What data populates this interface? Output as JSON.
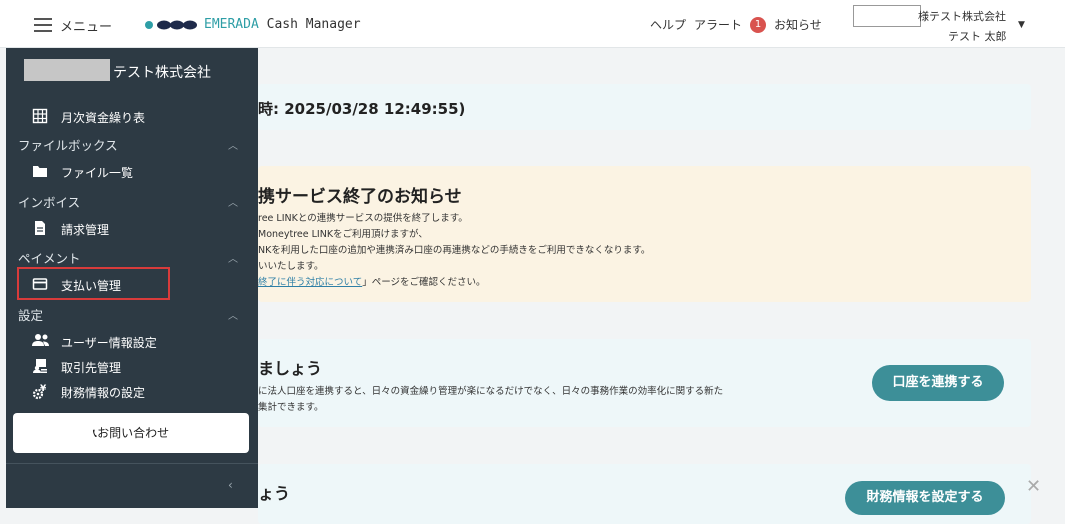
{
  "header": {
    "menu_label": "メニュー",
    "brand_primary": "EMERADA",
    "brand_secondary": "Cash Manager",
    "help": "ヘルプ",
    "alert": "アラート",
    "alert_count": "1",
    "notice": "お知らせ",
    "company_suffix": "様テスト株式会社",
    "user_name": "テスト 太郎",
    "accent_color": "#2e9ea6"
  },
  "sidebar": {
    "company_name": "テスト株式会社",
    "items": [
      {
        "label": "月次資金繰り表",
        "icon": "table-icon"
      },
      {
        "label": "ファイル一覧",
        "icon": "folder-icon"
      },
      {
        "label": "請求管理",
        "icon": "document-icon"
      },
      {
        "label": "支払い管理",
        "icon": "card-icon"
      },
      {
        "label": "ユーザー情報設定",
        "icon": "users-icon"
      },
      {
        "label": "取引先管理",
        "icon": "client-icon"
      },
      {
        "label": "財務情報の設定",
        "icon": "finance-settings-icon"
      }
    ],
    "sections": [
      "ファイルボックス",
      "インボイス",
      "ペイメント",
      "設定"
    ],
    "contact_label": "お問い合わせ"
  },
  "main": {
    "update_text": "時: 2025/03/28 12:49:55)",
    "notice": {
      "title": "携サービス終了のお知らせ",
      "lines": [
        "ree LINKとの連携サービスの提供を終了します。",
        "Moneytree LINKをご利用頂けますが、",
        "NKを利用した口座の追加や連携済み口座の再連携などの手続きをご利用できなくなります。",
        "いいたします。"
      ],
      "link_text": "終了に伴う対応について",
      "link_suffix": "」ページをご確認ください。"
    },
    "link_account": {
      "title": "ましょう",
      "desc1": "に法人口座を連携すると、日々の資金繰り管理が楽になるだけでなく、日々の事務作業の効率化に関する新た",
      "desc2": "集計できます。",
      "button": "口座を連携する"
    },
    "finance": {
      "title": "ょう",
      "button": "財務情報を設定する"
    }
  }
}
